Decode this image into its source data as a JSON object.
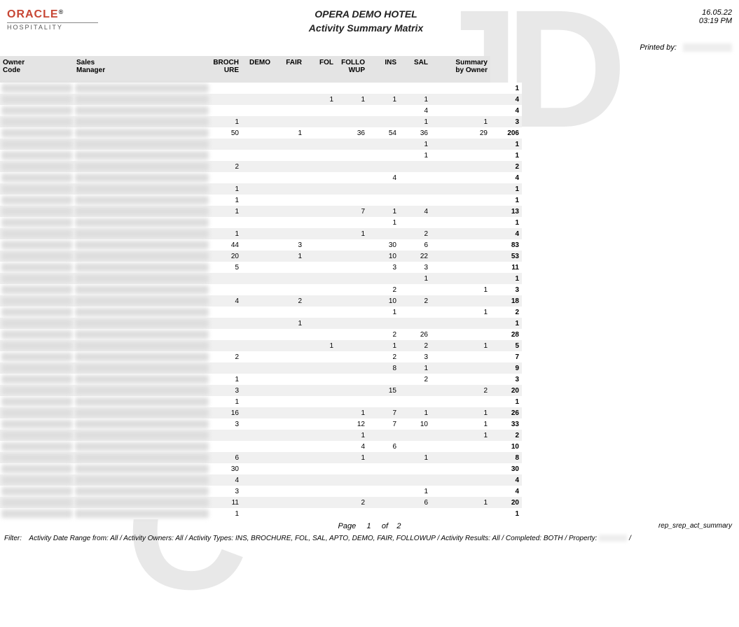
{
  "logo": {
    "brand": "ORACLE",
    "reg": "®",
    "sub": "HOSPITALITY"
  },
  "header": {
    "hotel": "OPERA DEMO HOTEL",
    "title": "Activity Summary Matrix",
    "date": "16.05.22",
    "time": "03:19 PM",
    "printed_by_label": "Printed by:"
  },
  "columns": [
    "Owner Code",
    "Sales Manager",
    "BROCH URE",
    "DEMO",
    "FAIR",
    "FOL",
    "FOLLO WUP",
    "INS",
    "SAL",
    "Summary by Owner"
  ],
  "rows": [
    {
      "v": [
        "",
        "",
        "",
        "",
        "",
        "",
        "",
        "",
        "1"
      ],
      "sum": "1"
    },
    {
      "v": [
        "",
        "",
        "",
        "1",
        "1",
        "1",
        "1",
        ""
      ],
      "sum": "4"
    },
    {
      "v": [
        "",
        "",
        "",
        "",
        "",
        "",
        "4",
        ""
      ],
      "sum": "4"
    },
    {
      "v": [
        "1",
        "",
        "",
        "",
        "",
        "",
        "1",
        "1"
      ],
      "sum": "3"
    },
    {
      "v": [
        "50",
        "",
        "1",
        "",
        "36",
        "54",
        "36",
        "29"
      ],
      "sum": "206"
    },
    {
      "v": [
        "",
        "",
        "",
        "",
        "",
        "",
        "1",
        ""
      ],
      "sum": "1"
    },
    {
      "v": [
        "",
        "",
        "",
        "",
        "",
        "",
        "1",
        ""
      ],
      "sum": "1"
    },
    {
      "v": [
        "2",
        "",
        "",
        "",
        "",
        "",
        "",
        ""
      ],
      "sum": "2"
    },
    {
      "v": [
        "",
        "",
        "",
        "",
        "",
        "4",
        "",
        ""
      ],
      "sum": "4"
    },
    {
      "v": [
        "1",
        "",
        "",
        "",
        "",
        "",
        "",
        ""
      ],
      "sum": "1"
    },
    {
      "v": [
        "1",
        "",
        "",
        "",
        "",
        "",
        "",
        ""
      ],
      "sum": "1"
    },
    {
      "v": [
        "1",
        "",
        "",
        "",
        "7",
        "1",
        "4",
        ""
      ],
      "sum": "13"
    },
    {
      "v": [
        "",
        "",
        "",
        "",
        "",
        "1",
        "",
        ""
      ],
      "sum": "1"
    },
    {
      "v": [
        "1",
        "",
        "",
        "",
        "1",
        "",
        "2",
        ""
      ],
      "sum": "4"
    },
    {
      "v": [
        "44",
        "",
        "3",
        "",
        "",
        "30",
        "6",
        ""
      ],
      "sum": "83"
    },
    {
      "v": [
        "20",
        "",
        "1",
        "",
        "",
        "10",
        "22",
        ""
      ],
      "sum": "53"
    },
    {
      "v": [
        "5",
        "",
        "",
        "",
        "",
        "3",
        "3",
        ""
      ],
      "sum": "11"
    },
    {
      "v": [
        "",
        "",
        "",
        "",
        "",
        "",
        "1",
        ""
      ],
      "sum": "1"
    },
    {
      "v": [
        "",
        "",
        "",
        "",
        "",
        "2",
        "",
        "1"
      ],
      "sum": "3"
    },
    {
      "v": [
        "4",
        "",
        "2",
        "",
        "",
        "10",
        "2",
        ""
      ],
      "sum": "18"
    },
    {
      "v": [
        "",
        "",
        "",
        "",
        "",
        "1",
        "",
        "1"
      ],
      "sum": "2"
    },
    {
      "v": [
        "",
        "",
        "1",
        "",
        "",
        "",
        "",
        ""
      ],
      "sum": "1"
    },
    {
      "v": [
        "",
        "",
        "",
        "",
        "",
        "2",
        "26",
        ""
      ],
      "sum": "28"
    },
    {
      "v": [
        "",
        "",
        "",
        "1",
        "",
        "1",
        "2",
        "1"
      ],
      "sum": "5"
    },
    {
      "v": [
        "2",
        "",
        "",
        "",
        "",
        "2",
        "3",
        ""
      ],
      "sum": "7"
    },
    {
      "v": [
        "",
        "",
        "",
        "",
        "",
        "8",
        "1",
        ""
      ],
      "sum": "9"
    },
    {
      "v": [
        "1",
        "",
        "",
        "",
        "",
        "",
        "2",
        ""
      ],
      "sum": "3"
    },
    {
      "v": [
        "3",
        "",
        "",
        "",
        "",
        "15",
        "",
        "2"
      ],
      "sum": "20"
    },
    {
      "v": [
        "1",
        "",
        "",
        "",
        "",
        "",
        "",
        ""
      ],
      "sum": "1"
    },
    {
      "v": [
        "16",
        "",
        "",
        "",
        "1",
        "7",
        "1",
        "1"
      ],
      "sum": "26"
    },
    {
      "v": [
        "3",
        "",
        "",
        "",
        "12",
        "7",
        "10",
        "1"
      ],
      "sum": "33"
    },
    {
      "v": [
        "",
        "",
        "",
        "",
        "1",
        "",
        "",
        "1"
      ],
      "sum": "2"
    },
    {
      "v": [
        "",
        "",
        "",
        "",
        "4",
        "6",
        "",
        ""
      ],
      "sum": "10"
    },
    {
      "v": [
        "6",
        "",
        "",
        "",
        "1",
        "",
        "1",
        ""
      ],
      "sum": "8"
    },
    {
      "v": [
        "30",
        "",
        "",
        "",
        "",
        "",
        "",
        ""
      ],
      "sum": "30"
    },
    {
      "v": [
        "4",
        "",
        "",
        "",
        "",
        "",
        "",
        ""
      ],
      "sum": "4"
    },
    {
      "v": [
        "3",
        "",
        "",
        "",
        "",
        "",
        "1",
        ""
      ],
      "sum": "4"
    },
    {
      "v": [
        "11",
        "",
        "",
        "",
        "2",
        "",
        "6",
        "1"
      ],
      "sum": "20"
    },
    {
      "v": [
        "1",
        "",
        "",
        "",
        "",
        "",
        "",
        ""
      ],
      "sum": "1"
    }
  ],
  "pager": {
    "label_page": "Page",
    "current": "1",
    "label_of": "of",
    "total": "2",
    "report_id": "rep_srep_act_summary"
  },
  "footer": {
    "label": "Filter:",
    "text": "Activity Date Range from:  All / Activity Owners: All / Activity Types: INS, BROCHURE, FOL, SAL, APTO, DEMO, FAIR, FOLLOWUP / Activity Results: All / Completed: BOTH / Property:",
    "trail": " /"
  }
}
